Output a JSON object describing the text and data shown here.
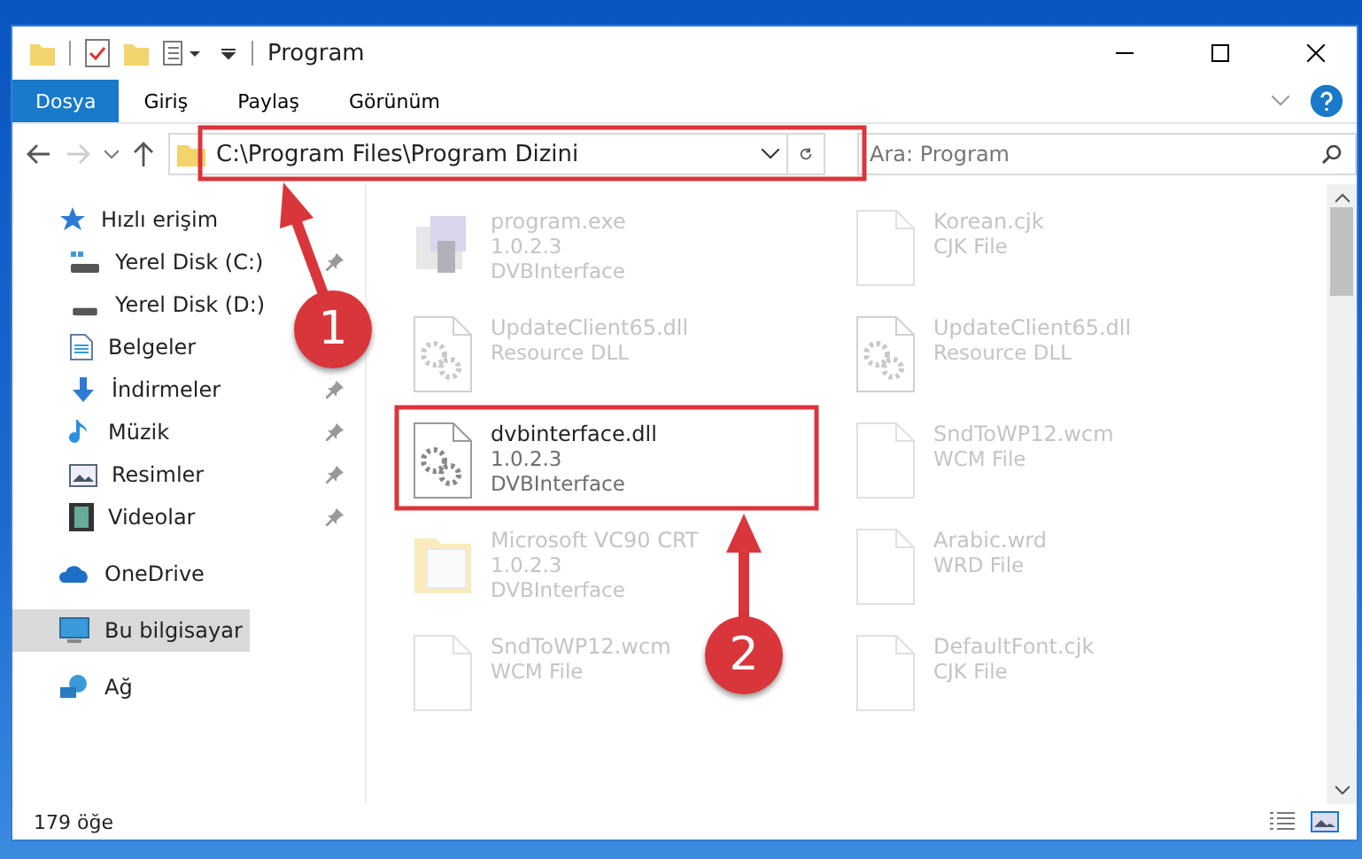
{
  "window": {
    "title": "Program"
  },
  "ribbon_tabs": [
    {
      "label": "Dosya",
      "selected": true
    },
    {
      "label": "Giriş",
      "selected": false
    },
    {
      "label": "Paylaş",
      "selected": false
    },
    {
      "label": "Görünüm",
      "selected": false
    }
  ],
  "address_bar": {
    "path": "C:\\Program Files\\Program Dizini"
  },
  "search": {
    "placeholder": "Ara: Program"
  },
  "sidebar": {
    "items": [
      {
        "label": "Hızlı erişim",
        "kind": "star",
        "selected": false,
        "children": [
          {
            "label": "Yerel Disk (C:)",
            "kind": "drive-c",
            "pinned": true,
            "selected": false
          },
          {
            "label": "Yerel Disk (D:)",
            "kind": "drive",
            "selected": false
          },
          {
            "label": "Belgeler",
            "kind": "document",
            "selected": false
          },
          {
            "label": "İndirmeler",
            "kind": "download",
            "pinned": true,
            "selected": false
          },
          {
            "label": "Müzik",
            "kind": "music",
            "pinned": true,
            "selected": false
          },
          {
            "label": "Resimler",
            "kind": "picture",
            "pinned": true,
            "selected": false
          },
          {
            "label": "Videolar",
            "kind": "video",
            "pinned": true,
            "selected": false
          }
        ]
      },
      {
        "label": "OneDrive",
        "kind": "cloud",
        "selected": false
      },
      {
        "label": "Bu bilgisayar",
        "kind": "computer",
        "selected": true
      },
      {
        "label": "Ağ",
        "kind": "network",
        "selected": false
      }
    ]
  },
  "files": [
    {
      "name": "program.exe",
      "lines": [
        "1.0.2.3",
        "DVBInterface"
      ],
      "kind": "exe",
      "dimmed": true
    },
    {
      "name": "Korean.cjk",
      "lines": [
        "CJK File"
      ],
      "kind": "file",
      "dimmed": true
    },
    {
      "name": "UpdateClient65.dll",
      "lines": [
        "Resource DLL"
      ],
      "kind": "dll",
      "dimmed": true
    },
    {
      "name": "UpdateClient65.dll",
      "lines": [
        "Resource DLL"
      ],
      "kind": "dll",
      "dimmed": true
    },
    {
      "name": "dvbinterface.dll",
      "lines": [
        "1.0.2.3",
        "DVBInterface"
      ],
      "kind": "dll",
      "dimmed": false
    },
    {
      "name": "SndToWP12.wcm",
      "lines": [
        "WCM File"
      ],
      "kind": "file",
      "dimmed": true
    },
    {
      "name": "Microsoft VC90 CRT",
      "lines": [
        "1.0.2.3",
        "DVBInterface"
      ],
      "kind": "folder",
      "dimmed": true
    },
    {
      "name": "Arabic.wrd",
      "lines": [
        "WRD File"
      ],
      "kind": "file",
      "dimmed": true
    },
    {
      "name": "SndToWP12.wcm",
      "lines": [
        "WCM File"
      ],
      "kind": "file",
      "dimmed": true
    },
    {
      "name": "DefaultFont.cjk",
      "lines": [
        "CJK File"
      ],
      "kind": "file",
      "dimmed": true
    }
  ],
  "status_bar": {
    "count": "179 öğe"
  },
  "annotations": [
    {
      "label": "1"
    },
    {
      "label": "2"
    }
  ]
}
